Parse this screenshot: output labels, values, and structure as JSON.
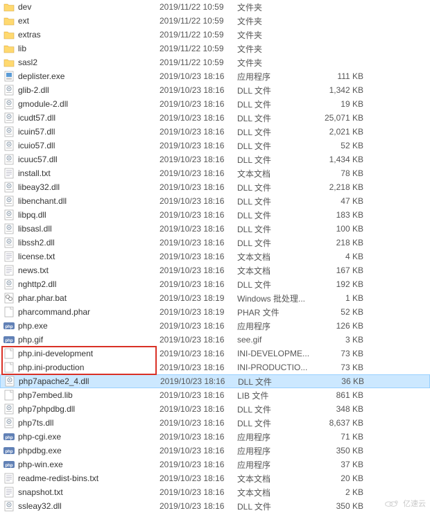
{
  "watermark": "亿速云",
  "files": [
    {
      "name": "dev",
      "date": "2019/11/22 10:59",
      "type": "文件夹",
      "size": "",
      "icon": "folder"
    },
    {
      "name": "ext",
      "date": "2019/11/22 10:59",
      "type": "文件夹",
      "size": "",
      "icon": "folder"
    },
    {
      "name": "extras",
      "date": "2019/11/22 10:59",
      "type": "文件夹",
      "size": "",
      "icon": "folder"
    },
    {
      "name": "lib",
      "date": "2019/11/22 10:59",
      "type": "文件夹",
      "size": "",
      "icon": "folder"
    },
    {
      "name": "sasl2",
      "date": "2019/11/22 10:59",
      "type": "文件夹",
      "size": "",
      "icon": "folder"
    },
    {
      "name": "deplister.exe",
      "date": "2019/10/23 18:16",
      "type": "应用程序",
      "size": "111 KB",
      "icon": "exe"
    },
    {
      "name": "glib-2.dll",
      "date": "2019/10/23 18:16",
      "type": "DLL 文件",
      "size": "1,342 KB",
      "icon": "dll"
    },
    {
      "name": "gmodule-2.dll",
      "date": "2019/10/23 18:16",
      "type": "DLL 文件",
      "size": "19 KB",
      "icon": "dll"
    },
    {
      "name": "icudt57.dll",
      "date": "2019/10/23 18:16",
      "type": "DLL 文件",
      "size": "25,071 KB",
      "icon": "dll"
    },
    {
      "name": "icuin57.dll",
      "date": "2019/10/23 18:16",
      "type": "DLL 文件",
      "size": "2,021 KB",
      "icon": "dll"
    },
    {
      "name": "icuio57.dll",
      "date": "2019/10/23 18:16",
      "type": "DLL 文件",
      "size": "52 KB",
      "icon": "dll"
    },
    {
      "name": "icuuc57.dll",
      "date": "2019/10/23 18:16",
      "type": "DLL 文件",
      "size": "1,434 KB",
      "icon": "dll"
    },
    {
      "name": "install.txt",
      "date": "2019/10/23 18:16",
      "type": "文本文档",
      "size": "78 KB",
      "icon": "txt"
    },
    {
      "name": "libeay32.dll",
      "date": "2019/10/23 18:16",
      "type": "DLL 文件",
      "size": "2,218 KB",
      "icon": "dll"
    },
    {
      "name": "libenchant.dll",
      "date": "2019/10/23 18:16",
      "type": "DLL 文件",
      "size": "47 KB",
      "icon": "dll"
    },
    {
      "name": "libpq.dll",
      "date": "2019/10/23 18:16",
      "type": "DLL 文件",
      "size": "183 KB",
      "icon": "dll"
    },
    {
      "name": "libsasl.dll",
      "date": "2019/10/23 18:16",
      "type": "DLL 文件",
      "size": "100 KB",
      "icon": "dll"
    },
    {
      "name": "libssh2.dll",
      "date": "2019/10/23 18:16",
      "type": "DLL 文件",
      "size": "218 KB",
      "icon": "dll"
    },
    {
      "name": "license.txt",
      "date": "2019/10/23 18:16",
      "type": "文本文档",
      "size": "4 KB",
      "icon": "txt"
    },
    {
      "name": "news.txt",
      "date": "2019/10/23 18:16",
      "type": "文本文档",
      "size": "167 KB",
      "icon": "txt"
    },
    {
      "name": "nghttp2.dll",
      "date": "2019/10/23 18:16",
      "type": "DLL 文件",
      "size": "192 KB",
      "icon": "dll"
    },
    {
      "name": "phar.phar.bat",
      "date": "2019/10/23 18:19",
      "type": "Windows 批处理...",
      "size": "1 KB",
      "icon": "bat"
    },
    {
      "name": "pharcommand.phar",
      "date": "2019/10/23 18:19",
      "type": "PHAR 文件",
      "size": "52 KB",
      "icon": "file"
    },
    {
      "name": "php.exe",
      "date": "2019/10/23 18:16",
      "type": "应用程序",
      "size": "126 KB",
      "icon": "php"
    },
    {
      "name": "php.gif",
      "date": "2019/10/23 18:16",
      "type": "see.gif",
      "size": "3 KB",
      "icon": "php"
    },
    {
      "name": "php.ini-development",
      "date": "2019/10/23 18:16",
      "type": "INI-DEVELOPME...",
      "size": "73 KB",
      "icon": "file"
    },
    {
      "name": "php.ini-production",
      "date": "2019/10/23 18:16",
      "type": "INI-PRODUCTIO...",
      "size": "73 KB",
      "icon": "file"
    },
    {
      "name": "php7apache2_4.dll",
      "date": "2019/10/23 18:16",
      "type": "DLL 文件",
      "size": "36 KB",
      "icon": "dll",
      "selected": true
    },
    {
      "name": "php7embed.lib",
      "date": "2019/10/23 18:16",
      "type": "LIB 文件",
      "size": "861 KB",
      "icon": "file"
    },
    {
      "name": "php7phpdbg.dll",
      "date": "2019/10/23 18:16",
      "type": "DLL 文件",
      "size": "348 KB",
      "icon": "dll"
    },
    {
      "name": "php7ts.dll",
      "date": "2019/10/23 18:16",
      "type": "DLL 文件",
      "size": "8,637 KB",
      "icon": "dll"
    },
    {
      "name": "php-cgi.exe",
      "date": "2019/10/23 18:16",
      "type": "应用程序",
      "size": "71 KB",
      "icon": "php"
    },
    {
      "name": "phpdbg.exe",
      "date": "2019/10/23 18:16",
      "type": "应用程序",
      "size": "350 KB",
      "icon": "php"
    },
    {
      "name": "php-win.exe",
      "date": "2019/10/23 18:16",
      "type": "应用程序",
      "size": "37 KB",
      "icon": "php"
    },
    {
      "name": "readme-redist-bins.txt",
      "date": "2019/10/23 18:16",
      "type": "文本文档",
      "size": "20 KB",
      "icon": "txt"
    },
    {
      "name": "snapshot.txt",
      "date": "2019/10/23 18:16",
      "type": "文本文档",
      "size": "2 KB",
      "icon": "txt"
    },
    {
      "name": "ssleay32.dll",
      "date": "2019/10/23 18:16",
      "type": "DLL 文件",
      "size": "350 KB",
      "icon": "dll"
    }
  ]
}
